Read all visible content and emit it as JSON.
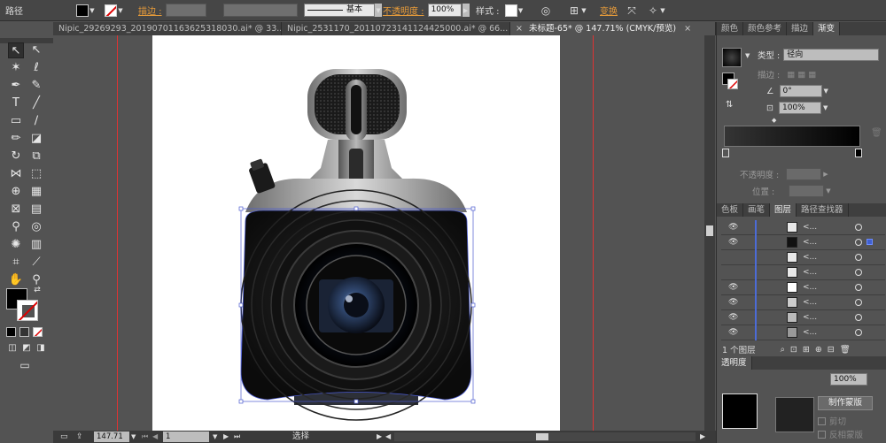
{
  "control_bar": {
    "object_label": "路径",
    "stroke_label": "描边 :",
    "stroke_profile": "基本",
    "opacity_label": "不透明度 :",
    "opacity_value": "100%",
    "style_label": "样式 :",
    "transform_label": "变换"
  },
  "tabs": [
    {
      "label": "Nipic_29269293_20190701163625318030.ai* @ 33..."
    },
    {
      "label": "Nipic_2531170_20110723141124425000.ai* @ 66..."
    },
    {
      "label": "未标题-65* @ 147.71% (CMYK/预览)"
    }
  ],
  "status_bar": {
    "zoom": "147.71",
    "page": "1",
    "tool_status": "选择"
  },
  "panels": {
    "top_tabs": [
      "颜色",
      "颜色参考",
      "描边",
      "渐变"
    ],
    "gradient": {
      "type_label": "类型 :",
      "type_value": "径向",
      "stroke_label": "描边 :",
      "angle_value": "0°",
      "aspect_value": "100%",
      "opacity_label": "不透明度 :",
      "position_label": "位置 :"
    },
    "layer_tabs": [
      "色板",
      "画笔",
      "图层",
      "路径查找器"
    ],
    "layers_count": "1 个图层",
    "layer_items": [
      {
        "name": "<...",
        "visible": true
      },
      {
        "name": "<...",
        "visible": true
      },
      {
        "name": "<...",
        "visible": false
      },
      {
        "name": "<...",
        "visible": false
      },
      {
        "name": "<...",
        "visible": true
      },
      {
        "name": "<...",
        "visible": true
      },
      {
        "name": "<...",
        "visible": true
      },
      {
        "name": "<...",
        "visible": true
      }
    ],
    "transparency_tab": "透明度",
    "transparency_value": "100%",
    "make_mask_label": "制作蒙版",
    "clip_label": "剪切",
    "invert_mask_label": "反相蒙版"
  },
  "colors": {
    "panel_bg": "#535353",
    "tab_bg": "#3f3f3f",
    "accent_orange": "#e79b3a",
    "guide_red": "#dd3333",
    "selection_blue": "#4c6bd6"
  }
}
